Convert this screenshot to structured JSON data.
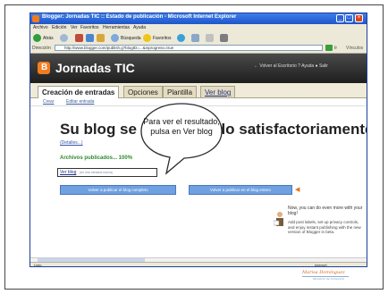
{
  "window": {
    "title": "Blogger: Jornadas TIC :: Estado de publicación - Microsoft Internet Explorer",
    "min_label": "_",
    "max_label": "□",
    "close_label": "×"
  },
  "menubar": [
    "Archivo",
    "Edición",
    "Ver",
    "Favoritos",
    "Herramientas",
    "Ayuda"
  ],
  "toolbar": {
    "back_label": "Atrás",
    "search_label": "Búsqueda",
    "favorites_label": "Favoritos"
  },
  "addressbar": {
    "label": "Dirección",
    "url": "http://www.blogger.com/publish.g?blogID=...&inprogress=true",
    "go_label": "Ir",
    "links_label": "Vínculos"
  },
  "blogger": {
    "title": "Jornadas TIC",
    "links": "← Volver al Escritorio  ?  Ayuda  ●  Salir",
    "tabs": [
      {
        "label": "Creación de entradas"
      },
      {
        "label": "Opciones"
      },
      {
        "label": "Plantilla"
      },
      {
        "label": "Ver blog"
      }
    ],
    "subtabs": [
      "Crear",
      "Editar entrada"
    ],
    "headline": "Su blog se ha publicado satisfactoriamente.",
    "details": "(Detalles...)",
    "published": "Archivos publicados... 100%",
    "view_blog_link": "Ver blog",
    "view_blog_sub": "(en una ventana nueva)",
    "btn_new_post": "Volver a publicar el blog completo",
    "btn_republish": "Volver a publicar en el blog entero",
    "tip_title": "Now, you can do even more with your blog!",
    "tip_body": "Add post labels, set up privacy controls, and enjoy instant publishing with the new version of Blogger in beta."
  },
  "status": {
    "left": "Listo",
    "right": "Internet"
  },
  "callout": {
    "text": "Para ver el resultado, pulsa en Ver blog"
  },
  "signature": {
    "name": "Marisa Domínguez",
    "sub": "Monitora de formación"
  }
}
